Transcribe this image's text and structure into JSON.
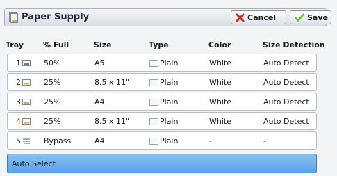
{
  "header": {
    "title": "Paper Supply",
    "cancel_label": "Cancel",
    "save_label": "Save"
  },
  "columns": {
    "tray": "Tray",
    "full": "% Full",
    "size": "Size",
    "type": "Type",
    "color": "Color",
    "detection": "Size Detection"
  },
  "rows": [
    {
      "tray": "1",
      "full": "50%",
      "size": "A5",
      "type": "Plain",
      "color": "White",
      "detection": "Auto Detect",
      "icon": "tray-level-icon"
    },
    {
      "tray": "2",
      "full": "25%",
      "size": "8.5 x 11\"",
      "type": "Plain",
      "color": "White",
      "detection": "Auto Detect",
      "icon": "tray-level-icon"
    },
    {
      "tray": "3",
      "full": "25%",
      "size": "A4",
      "type": "Plain",
      "color": "White",
      "detection": "Auto Detect",
      "icon": "tray-level-icon"
    },
    {
      "tray": "4",
      "full": "25%",
      "size": "8.5 x 11\"",
      "type": "Plain",
      "color": "White",
      "detection": "Auto Detect",
      "icon": "tray-level-icon"
    },
    {
      "tray": "5",
      "full": "Bypass",
      "size": "A4",
      "type": "Plain",
      "color": "-",
      "detection": "-",
      "icon": "bypass-tray-icon"
    }
  ],
  "auto_select": "Auto Select",
  "colors": {
    "selected_row": "#5aa4e8",
    "cancel_icon": "#d62b1f",
    "save_icon": "#6ab82a"
  }
}
